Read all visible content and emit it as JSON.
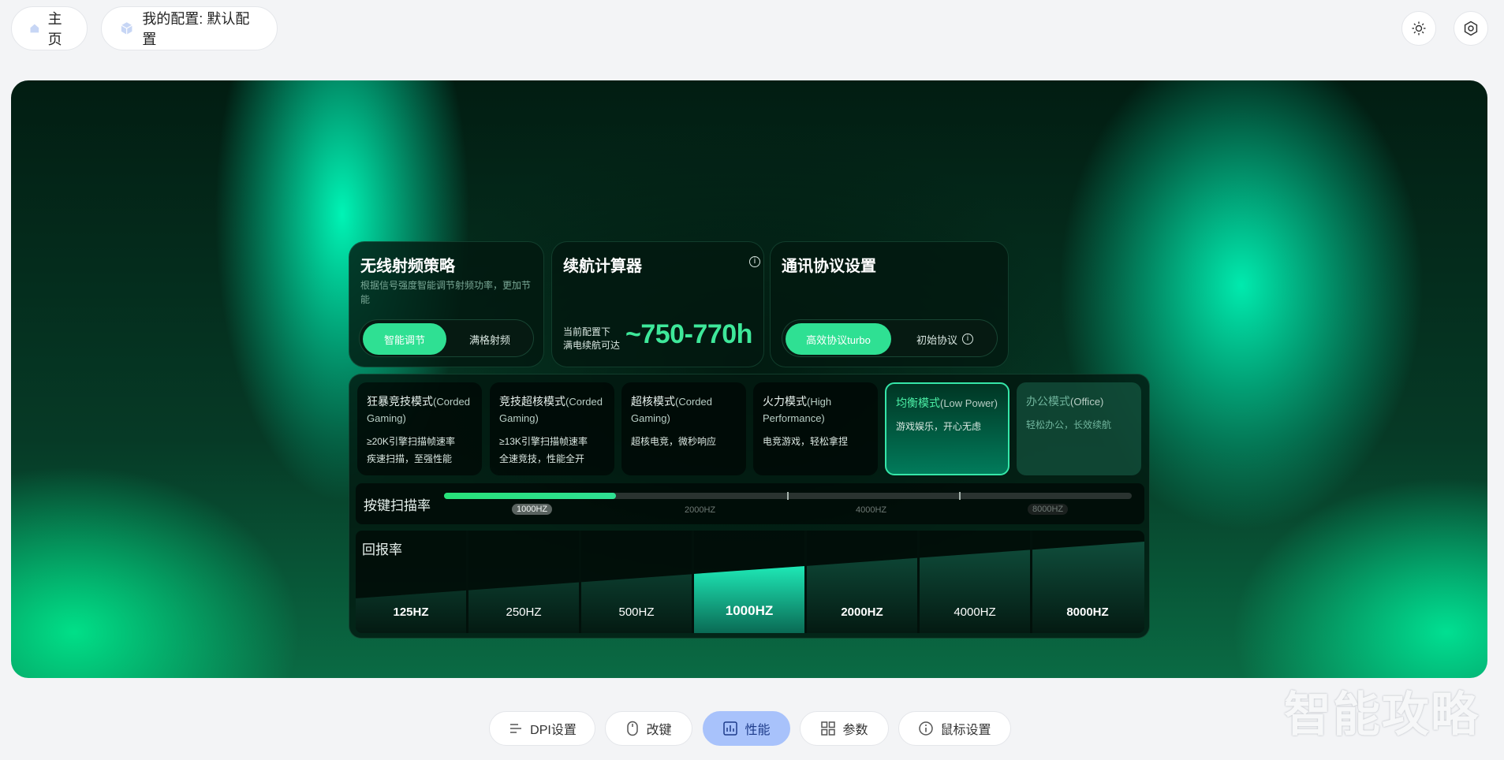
{
  "header": {
    "home_label": "主页",
    "config_label": "我的配置: 默认配置",
    "brightness_icon": "sun-icon",
    "settings_icon": "gear-icon"
  },
  "rf_card": {
    "title": "无线射频策略",
    "desc": "根据信号强度智能调节射频功率，更加节能",
    "options": [
      "智能调节",
      "满格射频"
    ],
    "selected": 0
  },
  "battery_card": {
    "title": "续航计算器",
    "line1": "当前配置下",
    "line2": "满电续航可达",
    "value": "~750-770h"
  },
  "protocol_card": {
    "title": "通讯协议设置",
    "options": [
      "高效协议turbo",
      "初始协议"
    ],
    "selected": 0
  },
  "modes": [
    {
      "name": "狂暴竞技模式",
      "en": "(Corded Gaming)",
      "desc": "≥20K引擎扫描帧速率\n疾速扫描，至强性能",
      "state": "normal"
    },
    {
      "name": "竞技超核模式",
      "en": "(Corded Gaming)",
      "desc": "≥13K引擎扫描帧速率\n全速竞技，性能全开",
      "state": "normal"
    },
    {
      "name": "超核模式",
      "en": "(Corded Gaming)",
      "desc": "超核电竞，微秒响应",
      "state": "normal"
    },
    {
      "name": "火力模式",
      "en": "(High Performance)",
      "desc": "电竞游戏，轻松拿捏",
      "state": "normal"
    },
    {
      "name": "均衡模式",
      "en": "(Low Power)",
      "desc": "游戏娱乐，开心无虑",
      "state": "active"
    },
    {
      "name": "办公模式",
      "en": "(Office)",
      "desc": "轻松办公，长效续航",
      "state": "dim"
    }
  ],
  "scan_rate": {
    "label": "按键扫描率",
    "ticks": [
      "1000HZ",
      "2000HZ",
      "4000HZ",
      "8000HZ"
    ],
    "selected": 0,
    "fill_fraction": 0.25
  },
  "report_rate": {
    "label": "回报率",
    "options": [
      "125HZ",
      "250HZ",
      "500HZ",
      "1000HZ",
      "2000HZ",
      "4000HZ",
      "8000HZ"
    ],
    "selected": 3
  },
  "bottom_nav": {
    "items": [
      {
        "label": "DPI设置",
        "icon": "dpi-icon"
      },
      {
        "label": "改键",
        "icon": "mouse-icon"
      },
      {
        "label": "性能",
        "icon": "performance-icon"
      },
      {
        "label": "参数",
        "icon": "grid-icon"
      },
      {
        "label": "鼠标设置",
        "icon": "info-icon"
      }
    ],
    "active": 2
  },
  "watermark": "智能攻略",
  "colors": {
    "accent": "#2fe093",
    "nav_active": "#a8c2fb",
    "mode_active_text": "#4cf0a7"
  }
}
